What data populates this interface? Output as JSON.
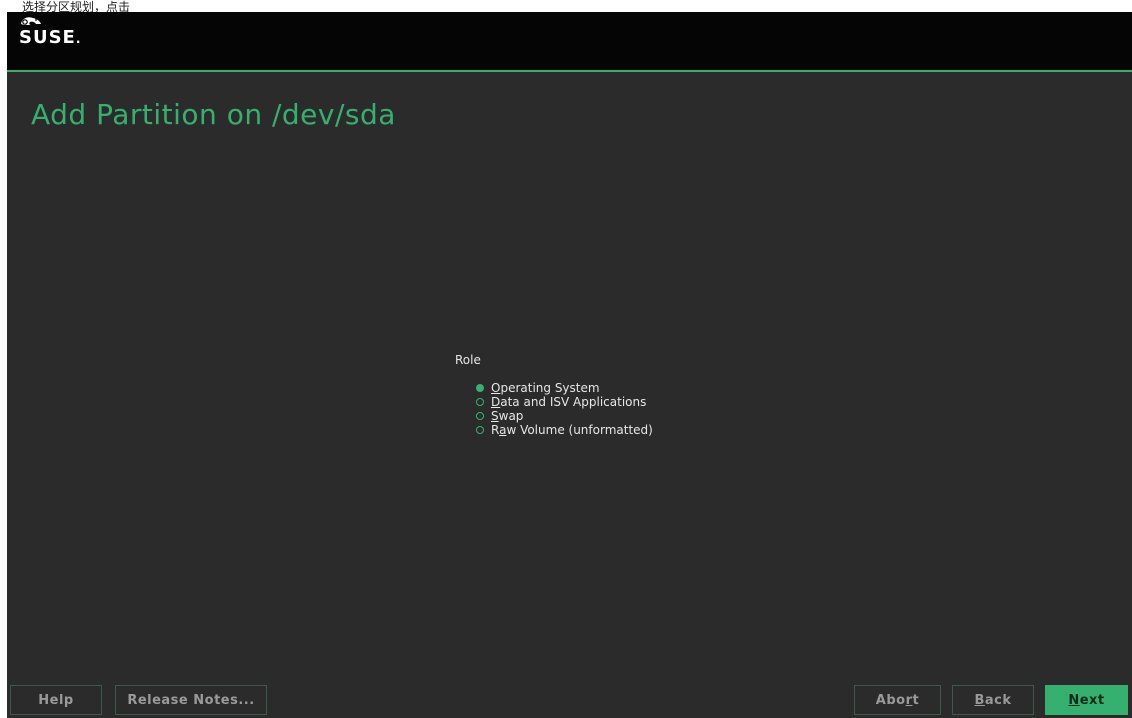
{
  "caption": "选择分区规划，点击",
  "colors": {
    "accent": "#35b06f",
    "background": "#2b2b2b",
    "header": "#050505",
    "text": "#e6e6e6"
  },
  "header": {
    "logo": "SUSE",
    "logo_dot": ".",
    "logo_icon": "chameleon-icon"
  },
  "page": {
    "title": "Add Partition on /dev/sda"
  },
  "role": {
    "label": "Role",
    "selected": "Operating System",
    "options": [
      {
        "mnemonic": "O",
        "rest": "perating System",
        "checked": true
      },
      {
        "mnemonic": "D",
        "rest": "ata and ISV Applications",
        "checked": false
      },
      {
        "mnemonic": "S",
        "rest": "wap",
        "checked": false
      },
      {
        "pre": "R",
        "mnemonic": "a",
        "rest": "w Volume (unformatted)",
        "checked": false
      }
    ]
  },
  "buttons": {
    "help": "Help",
    "release_notes": "Release Notes...",
    "abort_pre": "Abo",
    "abort_mnemonic": "r",
    "abort_post": "t",
    "back_mnemonic": "B",
    "back_rest": "ack",
    "next_mnemonic": "N",
    "next_rest": "ext"
  }
}
